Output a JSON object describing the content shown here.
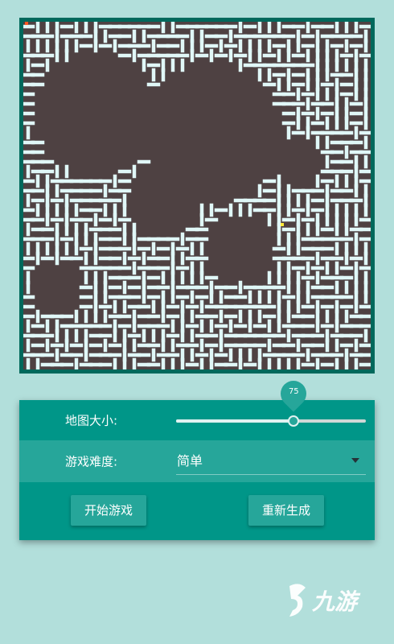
{
  "maze": {
    "wall_color": "#e0f7f7",
    "floor_color": "#4e4142",
    "frame_color": "#00695c",
    "start_marker_color": "#ff5722",
    "player_marker_color": "#ffeb3b"
  },
  "settings": {
    "map_size_label": "地图大小:",
    "map_size_value": "75",
    "map_size_fraction": 0.62,
    "difficulty_label": "游戏难度:",
    "difficulty_value": "简单"
  },
  "buttons": {
    "start_label": "开始游戏",
    "regenerate_label": "重新生成"
  },
  "watermark": {
    "text": "九游",
    "icon": "jiuyou-logo-icon"
  },
  "colors": {
    "background": "#b2dfdb",
    "panel": "#009688",
    "accent": "#26a69a"
  }
}
